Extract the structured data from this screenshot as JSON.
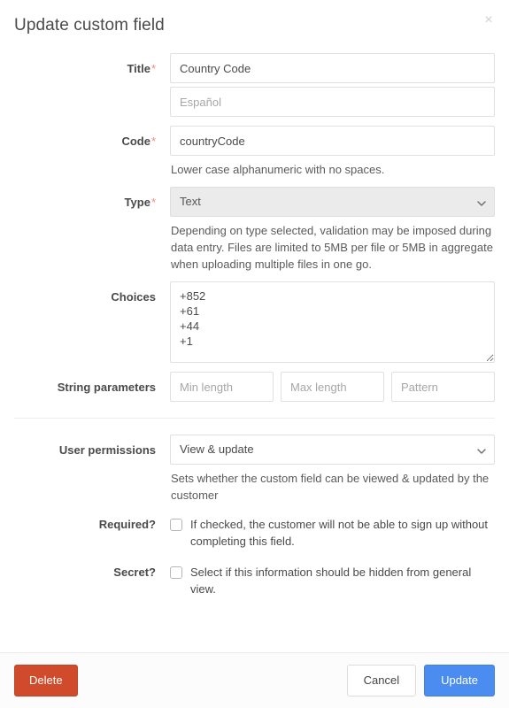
{
  "header": {
    "title": "Update custom field",
    "close_label": "×"
  },
  "form": {
    "title_field": {
      "label": "Title",
      "required_marker": "*",
      "value": "Country Code",
      "translation_placeholder": "Español"
    },
    "code_field": {
      "label": "Code",
      "required_marker": "*",
      "value": "countryCode",
      "help": "Lower case alphanumeric with no spaces."
    },
    "type_field": {
      "label": "Type",
      "required_marker": "*",
      "selected": "Text",
      "options": [
        "Text"
      ],
      "help": "Depending on type selected, validation may be imposed during data entry. Files are limited to 5MB per file or 5MB in aggregate when uploading multiple files in one go."
    },
    "choices_field": {
      "label": "Choices",
      "value": "+852\n+61\n+44\n+1"
    },
    "string_parameters": {
      "label": "String parameters",
      "min_length_placeholder": "Min length",
      "max_length_placeholder": "Max length",
      "pattern_placeholder": "Pattern"
    },
    "user_permissions": {
      "label": "User permissions",
      "selected": "View & update",
      "options": [
        "View & update"
      ],
      "help": "Sets whether the custom field can be viewed & updated by the customer"
    },
    "required_field": {
      "label": "Required?",
      "checked": false,
      "description": "If checked, the customer will not be able to sign up without completing this field."
    },
    "secret_field": {
      "label": "Secret?",
      "checked": false,
      "description": "Select if this information should be hidden from general view."
    }
  },
  "footer": {
    "delete_label": "Delete",
    "cancel_label": "Cancel",
    "update_label": "Update"
  },
  "colors": {
    "danger": "#cf4b2c",
    "primary": "#4a8cf0",
    "required_marker": "#f08c78",
    "disabled_field": "#ebebeb"
  }
}
